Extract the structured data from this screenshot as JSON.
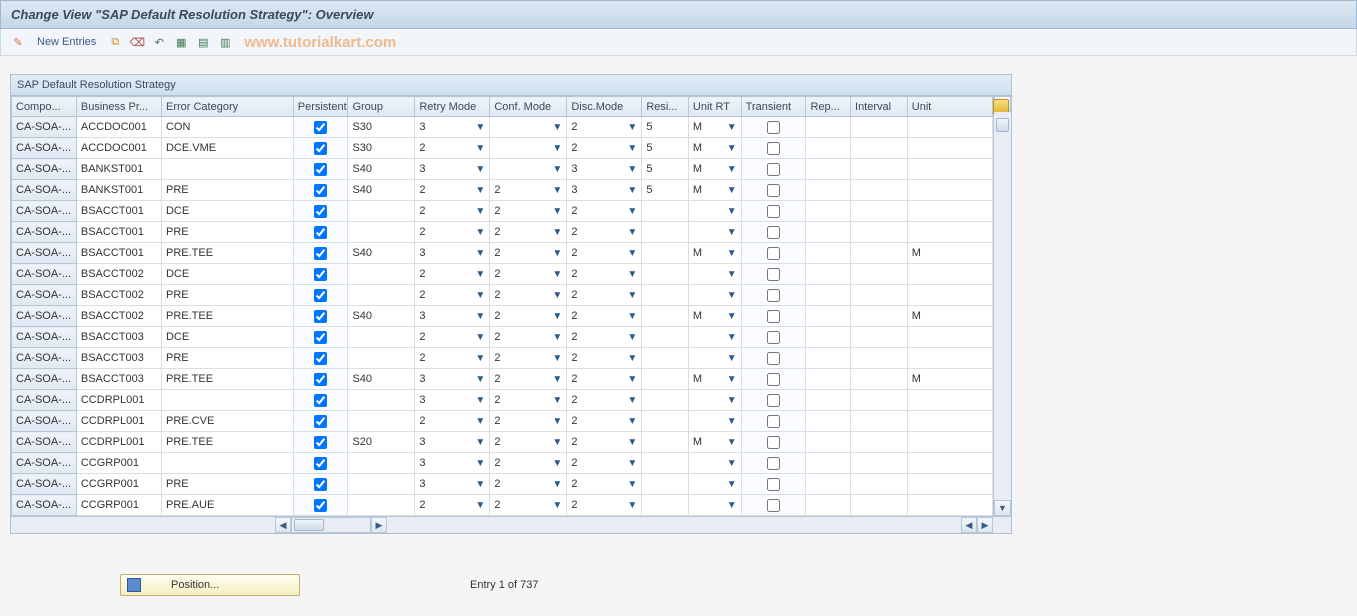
{
  "title": "Change View \"SAP Default Resolution Strategy\": Overview",
  "toolbar": {
    "new_entries": "New Entries"
  },
  "watermark": "www.tutorialkart.com",
  "panel_title": "SAP Default Resolution Strategy",
  "columns": {
    "compo": "Compo...",
    "business_pr": "Business Pr...",
    "error_cat": "Error Category",
    "persistent": "Persistent",
    "group": "Group",
    "retry_mode": "Retry Mode",
    "conf_mode": "Conf. Mode",
    "disc_mode": "Disc.Mode",
    "resi": "Resi...",
    "unit_rt": "Unit RT",
    "transient": "Transient",
    "rep": "Rep...",
    "interval": "Interval",
    "unit": "Unit"
  },
  "rows": [
    {
      "compo": "CA-SOA-...",
      "bp": "ACCDOC001",
      "ec": "CON",
      "persist": true,
      "group": "S30",
      "retry": "3",
      "conf": "",
      "disc": "2",
      "resi": "5",
      "unit_rt": "M",
      "transient": false,
      "rep": "",
      "interval": "",
      "unit": ""
    },
    {
      "compo": "CA-SOA-...",
      "bp": "ACCDOC001",
      "ec": "DCE.VME",
      "persist": true,
      "group": "S30",
      "retry": "2",
      "conf": "",
      "disc": "2",
      "resi": "5",
      "unit_rt": "M",
      "transient": false,
      "rep": "",
      "interval": "",
      "unit": ""
    },
    {
      "compo": "CA-SOA-...",
      "bp": "BANKST001",
      "ec": "",
      "persist": true,
      "group": "S40",
      "retry": "3",
      "conf": "",
      "disc": "3",
      "resi": "5",
      "unit_rt": "M",
      "transient": false,
      "rep": "",
      "interval": "",
      "unit": ""
    },
    {
      "compo": "CA-SOA-...",
      "bp": "BANKST001",
      "ec": "PRE",
      "persist": true,
      "group": "S40",
      "retry": "2",
      "conf": "2",
      "disc": "3",
      "resi": "5",
      "unit_rt": "M",
      "transient": false,
      "rep": "",
      "interval": "",
      "unit": ""
    },
    {
      "compo": "CA-SOA-...",
      "bp": "BSACCT001",
      "ec": "DCE",
      "persist": true,
      "group": "",
      "retry": "2",
      "conf": "2",
      "disc": "2",
      "resi": "",
      "unit_rt": "",
      "transient": false,
      "rep": "",
      "interval": "",
      "unit": ""
    },
    {
      "compo": "CA-SOA-...",
      "bp": "BSACCT001",
      "ec": "PRE",
      "persist": true,
      "group": "",
      "retry": "2",
      "conf": "2",
      "disc": "2",
      "resi": "",
      "unit_rt": "",
      "transient": false,
      "rep": "",
      "interval": "",
      "unit": ""
    },
    {
      "compo": "CA-SOA-...",
      "bp": "BSACCT001",
      "ec": "PRE.TEE",
      "persist": true,
      "group": "S40",
      "retry": "3",
      "conf": "2",
      "disc": "2",
      "resi": "",
      "unit_rt": "M",
      "transient": false,
      "rep": "",
      "interval": "",
      "unit": "M"
    },
    {
      "compo": "CA-SOA-...",
      "bp": "BSACCT002",
      "ec": "DCE",
      "persist": true,
      "group": "",
      "retry": "2",
      "conf": "2",
      "disc": "2",
      "resi": "",
      "unit_rt": "",
      "transient": false,
      "rep": "",
      "interval": "",
      "unit": ""
    },
    {
      "compo": "CA-SOA-...",
      "bp": "BSACCT002",
      "ec": "PRE",
      "persist": true,
      "group": "",
      "retry": "2",
      "conf": "2",
      "disc": "2",
      "resi": "",
      "unit_rt": "",
      "transient": false,
      "rep": "",
      "interval": "",
      "unit": ""
    },
    {
      "compo": "CA-SOA-...",
      "bp": "BSACCT002",
      "ec": "PRE.TEE",
      "persist": true,
      "group": "S40",
      "retry": "3",
      "conf": "2",
      "disc": "2",
      "resi": "",
      "unit_rt": "M",
      "transient": false,
      "rep": "",
      "interval": "",
      "unit": "M"
    },
    {
      "compo": "CA-SOA-...",
      "bp": "BSACCT003",
      "ec": "DCE",
      "persist": true,
      "group": "",
      "retry": "2",
      "conf": "2",
      "disc": "2",
      "resi": "",
      "unit_rt": "",
      "transient": false,
      "rep": "",
      "interval": "",
      "unit": ""
    },
    {
      "compo": "CA-SOA-...",
      "bp": "BSACCT003",
      "ec": "PRE",
      "persist": true,
      "group": "",
      "retry": "2",
      "conf": "2",
      "disc": "2",
      "resi": "",
      "unit_rt": "",
      "transient": false,
      "rep": "",
      "interval": "",
      "unit": ""
    },
    {
      "compo": "CA-SOA-...",
      "bp": "BSACCT003",
      "ec": "PRE.TEE",
      "persist": true,
      "group": "S40",
      "retry": "3",
      "conf": "2",
      "disc": "2",
      "resi": "",
      "unit_rt": "M",
      "transient": false,
      "rep": "",
      "interval": "",
      "unit": "M"
    },
    {
      "compo": "CA-SOA-...",
      "bp": "CCDRPL001",
      "ec": "",
      "persist": true,
      "group": "",
      "retry": "3",
      "conf": "2",
      "disc": "2",
      "resi": "",
      "unit_rt": "",
      "transient": false,
      "rep": "",
      "interval": "",
      "unit": ""
    },
    {
      "compo": "CA-SOA-...",
      "bp": "CCDRPL001",
      "ec": "PRE.CVE",
      "persist": true,
      "group": "",
      "retry": "2",
      "conf": "2",
      "disc": "2",
      "resi": "",
      "unit_rt": "",
      "transient": false,
      "rep": "",
      "interval": "",
      "unit": ""
    },
    {
      "compo": "CA-SOA-...",
      "bp": "CCDRPL001",
      "ec": "PRE.TEE",
      "persist": true,
      "group": "S20",
      "retry": "3",
      "conf": "2",
      "disc": "2",
      "resi": "",
      "unit_rt": "M",
      "transient": false,
      "rep": "",
      "interval": "",
      "unit": ""
    },
    {
      "compo": "CA-SOA-...",
      "bp": "CCGRP001",
      "ec": "",
      "persist": true,
      "group": "",
      "retry": "3",
      "conf": "2",
      "disc": "2",
      "resi": "",
      "unit_rt": "",
      "transient": false,
      "rep": "",
      "interval": "",
      "unit": ""
    },
    {
      "compo": "CA-SOA-...",
      "bp": "CCGRP001",
      "ec": "PRE",
      "persist": true,
      "group": "",
      "retry": "3",
      "conf": "2",
      "disc": "2",
      "resi": "",
      "unit_rt": "",
      "transient": false,
      "rep": "",
      "interval": "",
      "unit": ""
    },
    {
      "compo": "CA-SOA-...",
      "bp": "CCGRP001",
      "ec": "PRE.AUE",
      "persist": true,
      "group": "",
      "retry": "2",
      "conf": "2",
      "disc": "2",
      "resi": "",
      "unit_rt": "",
      "transient": false,
      "rep": "",
      "interval": "",
      "unit": ""
    }
  ],
  "footer": {
    "position_label": "Position...",
    "entry_status": "Entry 1 of 737"
  }
}
